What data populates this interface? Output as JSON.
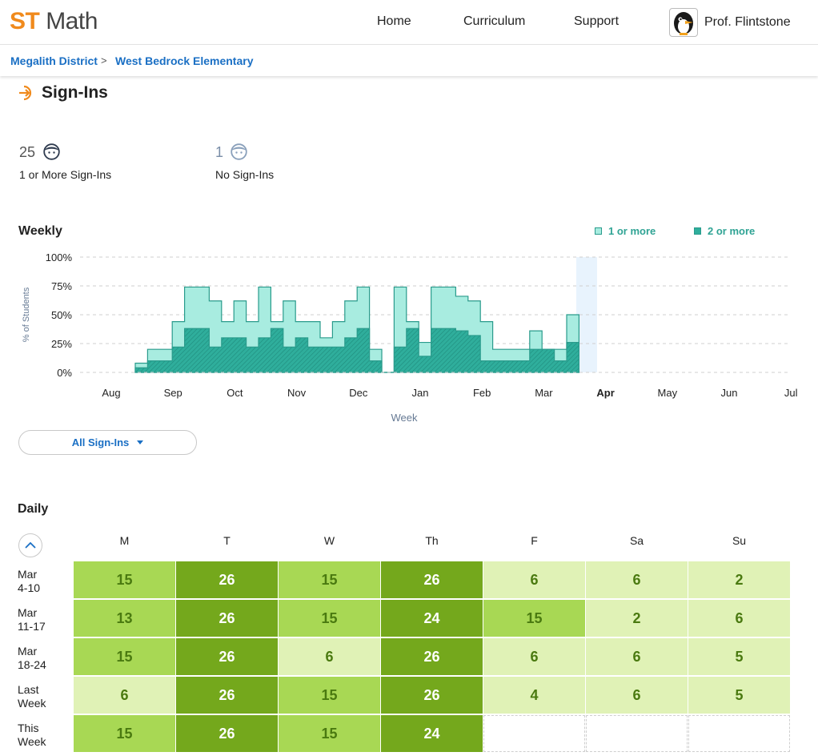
{
  "header": {
    "logo_st": "ST",
    "logo_math": "Math",
    "nav": [
      "Home",
      "Curriculum",
      "Support"
    ],
    "user_name": "Prof. Flintstone"
  },
  "breadcrumb": {
    "district": "Megalith District",
    "separator": ">",
    "school": "West Bedrock Elementary"
  },
  "page": {
    "title": "Sign-Ins"
  },
  "stats": [
    {
      "value": "25",
      "label": "1 or More Sign-Ins"
    },
    {
      "value": "1",
      "label": "No Sign-Ins"
    }
  ],
  "weekly": {
    "heading": "Weekly",
    "legend": [
      "1 or more",
      "2 or more"
    ]
  },
  "chart_data": {
    "type": "area",
    "ylabel": "% of Students",
    "xlabel": "Week",
    "ylim": [
      0,
      100
    ],
    "yticks": [
      "0%",
      "25%",
      "50%",
      "75%",
      "100%"
    ],
    "months": [
      "Aug",
      "Sep",
      "Oct",
      "Nov",
      "Dec",
      "Jan",
      "Feb",
      "Mar",
      "Apr",
      "May",
      "Jun",
      "Jul"
    ],
    "current_month": "Apr",
    "grid": true,
    "legend_position": "top-right",
    "colors": {
      "one_or_more": "#a8ece0",
      "two_or_more": "#2fae9c",
      "stroke": "#2a9b8c",
      "current_week": "#e8f3fd"
    },
    "series": [
      {
        "name": "1 or more",
        "values": [
          8,
          20,
          20,
          44,
          74,
          74,
          62,
          44,
          62,
          44,
          74,
          44,
          62,
          44,
          44,
          30,
          44,
          62,
          74,
          20,
          0,
          74,
          44,
          26,
          74,
          74,
          66,
          62,
          44,
          20,
          20,
          20,
          36,
          20,
          20,
          50
        ]
      },
      {
        "name": "2 or more",
        "values": [
          4,
          10,
          10,
          22,
          38,
          38,
          22,
          30,
          30,
          22,
          30,
          38,
          22,
          30,
          22,
          22,
          22,
          30,
          38,
          10,
          0,
          22,
          38,
          14,
          38,
          38,
          36,
          32,
          10,
          10,
          10,
          10,
          20,
          20,
          10,
          26
        ]
      }
    ]
  },
  "filter": {
    "label": "All Sign-Ins"
  },
  "daily": {
    "heading": "Daily",
    "days": [
      "M",
      "T",
      "W",
      "Th",
      "F",
      "Sa",
      "Su"
    ],
    "colors": [
      "#e0f2b6",
      "#a8d854",
      "#74a81c"
    ],
    "text_colors": [
      "#4a7a10",
      "#4a7a10",
      "#ffffff"
    ],
    "rows": [
      {
        "label": [
          "Mar",
          "4-10"
        ],
        "values": [
          15,
          26,
          15,
          26,
          6,
          6,
          2
        ],
        "levels": [
          1,
          2,
          1,
          2,
          0,
          0,
          0
        ]
      },
      {
        "label": [
          "Mar",
          "11-17"
        ],
        "values": [
          13,
          26,
          15,
          24,
          15,
          2,
          6
        ],
        "levels": [
          1,
          2,
          1,
          2,
          1,
          0,
          0
        ]
      },
      {
        "label": [
          "Mar",
          "18-24"
        ],
        "values": [
          15,
          26,
          6,
          26,
          6,
          6,
          5
        ],
        "levels": [
          1,
          2,
          0,
          2,
          0,
          0,
          0
        ]
      },
      {
        "label": [
          "Last",
          "Week"
        ],
        "values": [
          6,
          26,
          15,
          26,
          4,
          6,
          5
        ],
        "levels": [
          0,
          2,
          1,
          2,
          0,
          0,
          0
        ]
      },
      {
        "label": [
          "This",
          "Week"
        ],
        "values": [
          15,
          26,
          15,
          24,
          null,
          null,
          null
        ],
        "levels": [
          1,
          2,
          1,
          2,
          null,
          null,
          null
        ]
      }
    ]
  }
}
